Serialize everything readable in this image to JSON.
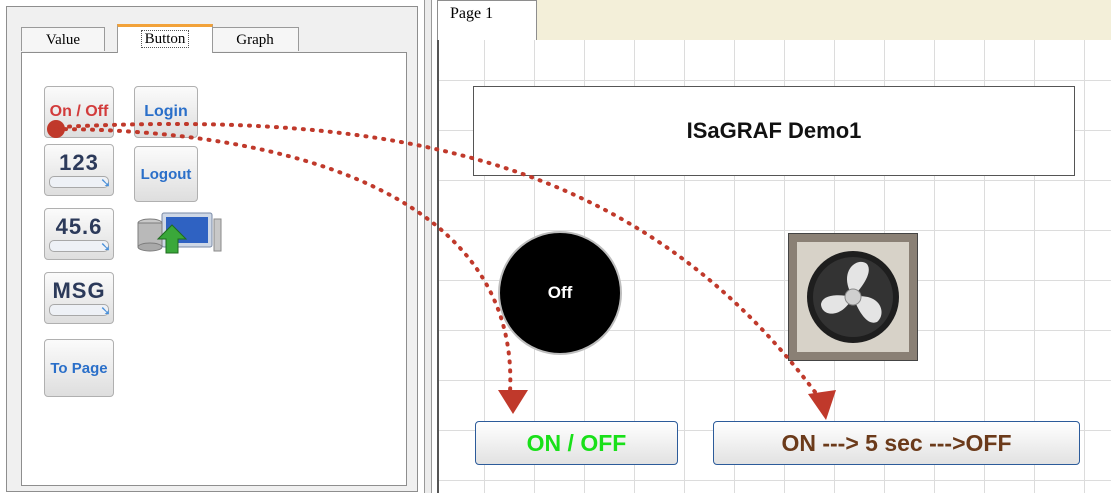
{
  "palette": {
    "tabs": [
      "Value",
      "Button",
      "Graph"
    ],
    "buttons": {
      "on_off": "On / Off",
      "login": "Login",
      "num_int": "123",
      "logout": "Logout",
      "num_float": "45.6",
      "msg": "MSG",
      "to_page": "To Page"
    }
  },
  "page": {
    "tab_label": "Page 1",
    "title": "ISaGRAF Demo1",
    "lamp_state": "Off",
    "on_off_button": "ON / OFF",
    "timer_button": "ON ---> 5 sec --->OFF"
  },
  "icons": [
    "upload-database-icon",
    "fan-icon",
    "num-cursor-icon"
  ],
  "colors": {
    "arrow": "#c0392b",
    "on_off_text": "#19e019",
    "timer_text": "#6b3a1a",
    "lamp_bg": "#000000",
    "tab_accent": "#f2a23a"
  }
}
